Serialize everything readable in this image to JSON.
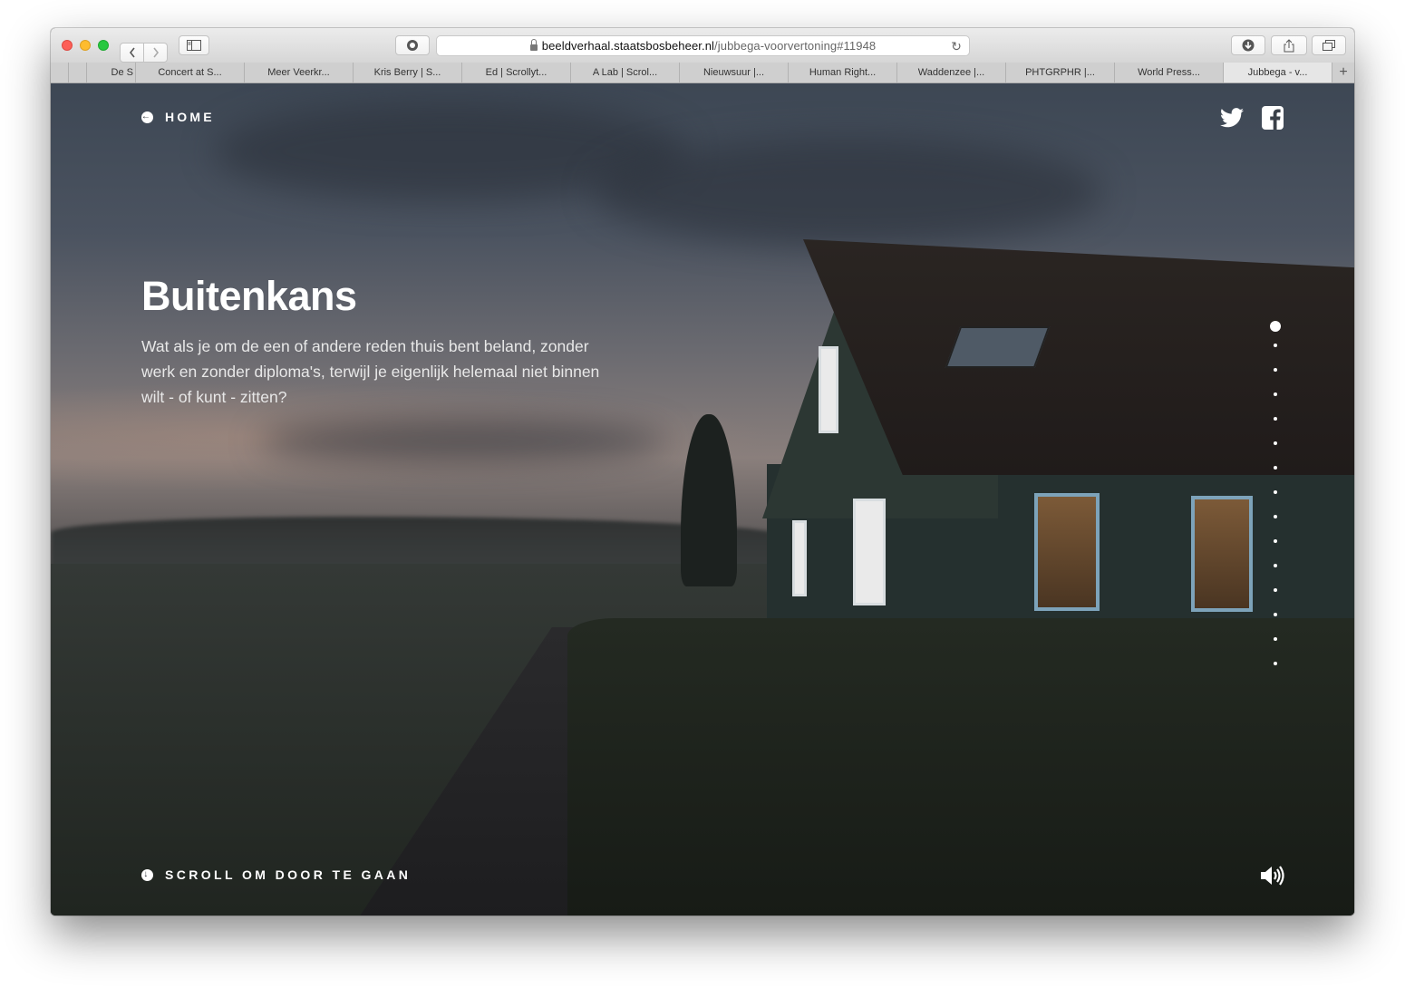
{
  "browser": {
    "url_domain": "beeldverhaal.staatsbosbeheer.nl",
    "url_path": "/jubbega-voorvertoning#11948",
    "tabs": [
      {
        "label": "De S"
      },
      {
        "label": "Concert at S..."
      },
      {
        "label": "Meer Veerkr..."
      },
      {
        "label": "Kris Berry | S..."
      },
      {
        "label": "Ed | Scrollyt..."
      },
      {
        "label": "A Lab | Scrol..."
      },
      {
        "label": "Nieuwsuur |..."
      },
      {
        "label": "Human Right..."
      },
      {
        "label": "Waddenzee |..."
      },
      {
        "label": "PHTGRPHR |..."
      },
      {
        "label": "World Press..."
      },
      {
        "label": "Jubbega - v..."
      }
    ],
    "active_tab": 11,
    "new_tab_label": "+"
  },
  "page": {
    "home_label": "HOME",
    "title": "Buitenkans",
    "intro": "Wat als je om de een of andere reden thuis bent beland, zonder werk en zonder diploma's, terwijl je eigenlijk helemaal niet binnen wilt - of kunt - zitten?",
    "scroll_label": "SCROLL OM DOOR TE GAAN",
    "section_count": 15,
    "active_section": 0
  },
  "icons": {
    "home": "arrow-left-circle-icon",
    "scroll": "arrow-down-circle-icon",
    "twitter": "twitter-icon",
    "facebook": "facebook-icon",
    "sound": "volume-icon"
  },
  "colors": {
    "text": "#ffffff",
    "chrome": "#dcdcdc"
  }
}
